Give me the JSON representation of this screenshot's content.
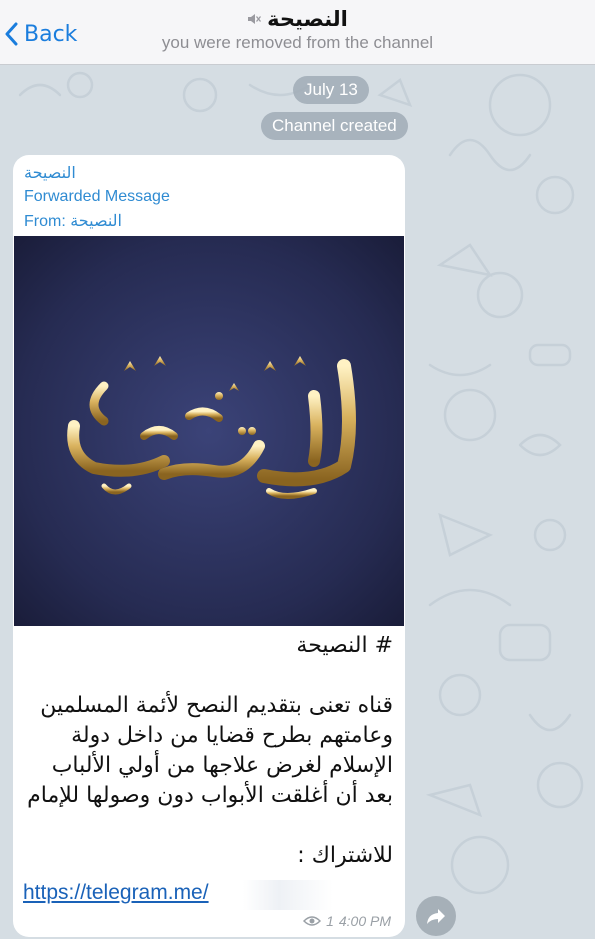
{
  "navbar": {
    "back_label": "Back",
    "title": "النصيحة",
    "subtitle": "you were removed from the channel"
  },
  "service": {
    "date": "July 13",
    "created": "Channel created"
  },
  "message": {
    "forward_name": "النصيحة",
    "forward_label": "Forwarded Message",
    "forward_from": "From: النصيحة",
    "photo_text": "النصيحة",
    "body": "# النصيحة\n\nقناه تعنى بتقديم النصح لأئمة المسلمين وعامتهم بطرح قضايا من داخل دولة الإسلام لغرض علاجها من أولي الألباب بعد أن أغلقت الأبواب دون وصولها للإمام\n\nللاشتراك :",
    "link": "https://telegram.me/",
    "views": "1",
    "time": "4:00 PM"
  },
  "colors": {
    "accent": "#1a7ddd",
    "link": "#1a62b8",
    "photo_bg": "#2a2f58"
  },
  "icons": {
    "back": "chevron-left-icon",
    "mute": "muted-speaker-icon",
    "views": "eye-icon",
    "share": "share-arrow-icon"
  }
}
